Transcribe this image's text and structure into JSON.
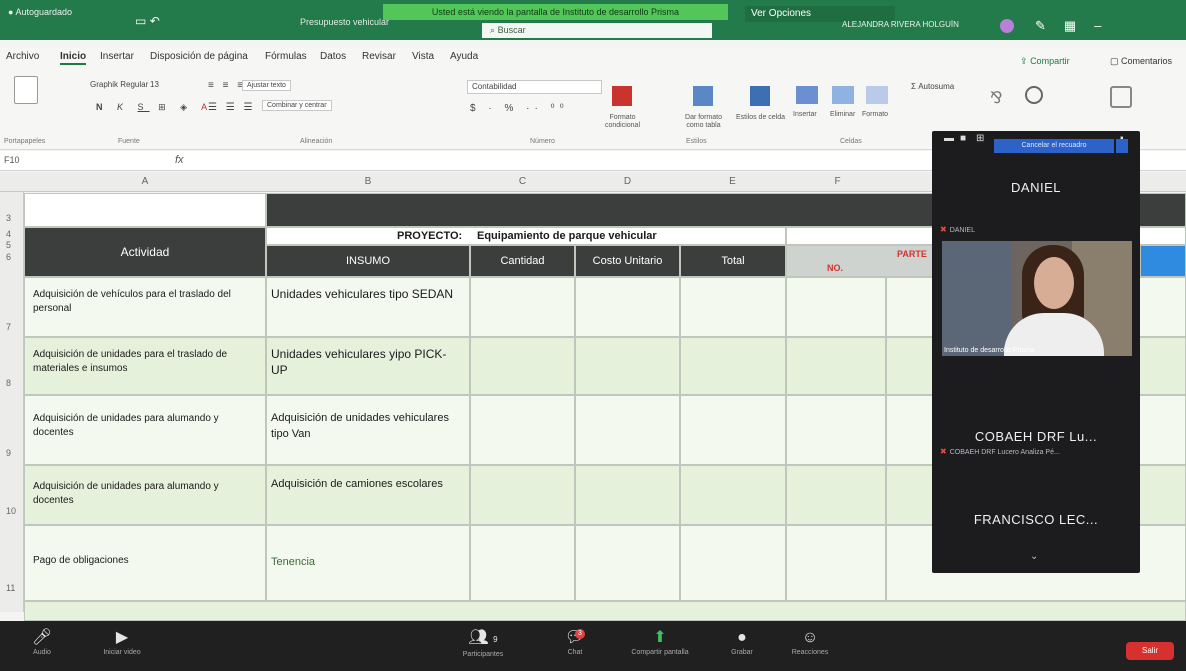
{
  "window": {
    "autosave": "Autoguardado",
    "doc_name": "Presupuesto vehicular",
    "share_banner": "Usted está viendo la pantalla de Instituto de desarrollo Prisma",
    "search_placeholder": "Buscar",
    "view_options": "Ver Opciones",
    "user_name": "ALEJANDRA RIVERA HOLGUÍN",
    "user_avatar": "avatar",
    "accent": "#237a4a"
  },
  "menu": {
    "tabs": [
      "Archivo",
      "Inicio",
      "Insertar",
      "Disposición de página",
      "Fórmulas",
      "Datos",
      "Revisar",
      "Vista",
      "Ayuda"
    ],
    "active_tab": "Inicio",
    "share": "Compartir",
    "comments": "Comentarios"
  },
  "ribbon": {
    "font_name": "Graphik Regular",
    "font_size": "13",
    "wrap_text": "Ajustar texto",
    "merge": "Combinar y centrar",
    "number_format": "Contabilidad",
    "conditional_format": "Formato condicional",
    "format_table": "Dar formato como tabla",
    "cell_styles": "Estilos de celda",
    "insert": "Insertar",
    "delete": "Eliminar",
    "format": "Formato",
    "autosum": "Autosuma",
    "groups": {
      "clipboard": "Portapapeles",
      "font": "Fuente",
      "alignment": "Alineación",
      "number": "Número",
      "styles": "Estilos",
      "cells": "Celdas"
    }
  },
  "formula_bar": {
    "cell_ref": "F10",
    "fx": "fx"
  },
  "sheet": {
    "columns": [
      "A",
      "B",
      "C",
      "D",
      "E",
      "F"
    ],
    "rows": [
      "3",
      "4",
      "5",
      "6",
      "7",
      "8",
      "9",
      "10",
      "11"
    ],
    "project_label": "PROYECTO:",
    "project_name": "Equipamiento de parque vehicular",
    "headers": {
      "actividad": "Actividad",
      "insumo": "INSUMO",
      "cantidad": "Cantidad",
      "costo_unitario": "Costo Unitario",
      "total": "Total",
      "partes": "PARTE",
      "no": "NO."
    },
    "data_rows": [
      {
        "actividad": "Adquisición de vehículos para el traslado del personal",
        "insumo": "Unidades vehiculares tipo SEDAN"
      },
      {
        "actividad": "Adquisición de unidades para el traslado de materiales e insumos",
        "insumo": "Unidades vehiculares yipo PICK-UP"
      },
      {
        "actividad": "Adquisición de unidades para alumando y docentes",
        "insumo": "Adquisición de unidades vehiculares tipo Van"
      },
      {
        "actividad": "Adquisición de unidades para alumando y docentes",
        "insumo": "Adquisición de camiones escolares"
      },
      {
        "actividad": "Pago de obligaciones",
        "insumo": "Tenencia"
      }
    ]
  },
  "zoom_panel": {
    "top_button": "Cancelar el recuadro",
    "participants": [
      {
        "name": "DANIEL",
        "sub": "DANIEL"
      },
      {
        "name": "",
        "sub": "Instituto de desarrollo Prisma"
      },
      {
        "name": "COBAEH DRF Lu...",
        "sub": "COBAEH DRF Lucero Analiza Pé..."
      },
      {
        "name": "FRANCISCO LEC...",
        "sub": ""
      }
    ]
  },
  "zoom_toolbar": {
    "audio": "Audio",
    "video": "Iniciar video",
    "participants": "Participantes",
    "participants_count": "9",
    "chat": "Chat",
    "chat_badge": "3",
    "share_screen": "Compartir pantalla",
    "record": "Grabar",
    "reactions": "Reacciones",
    "leave": "Salir"
  }
}
